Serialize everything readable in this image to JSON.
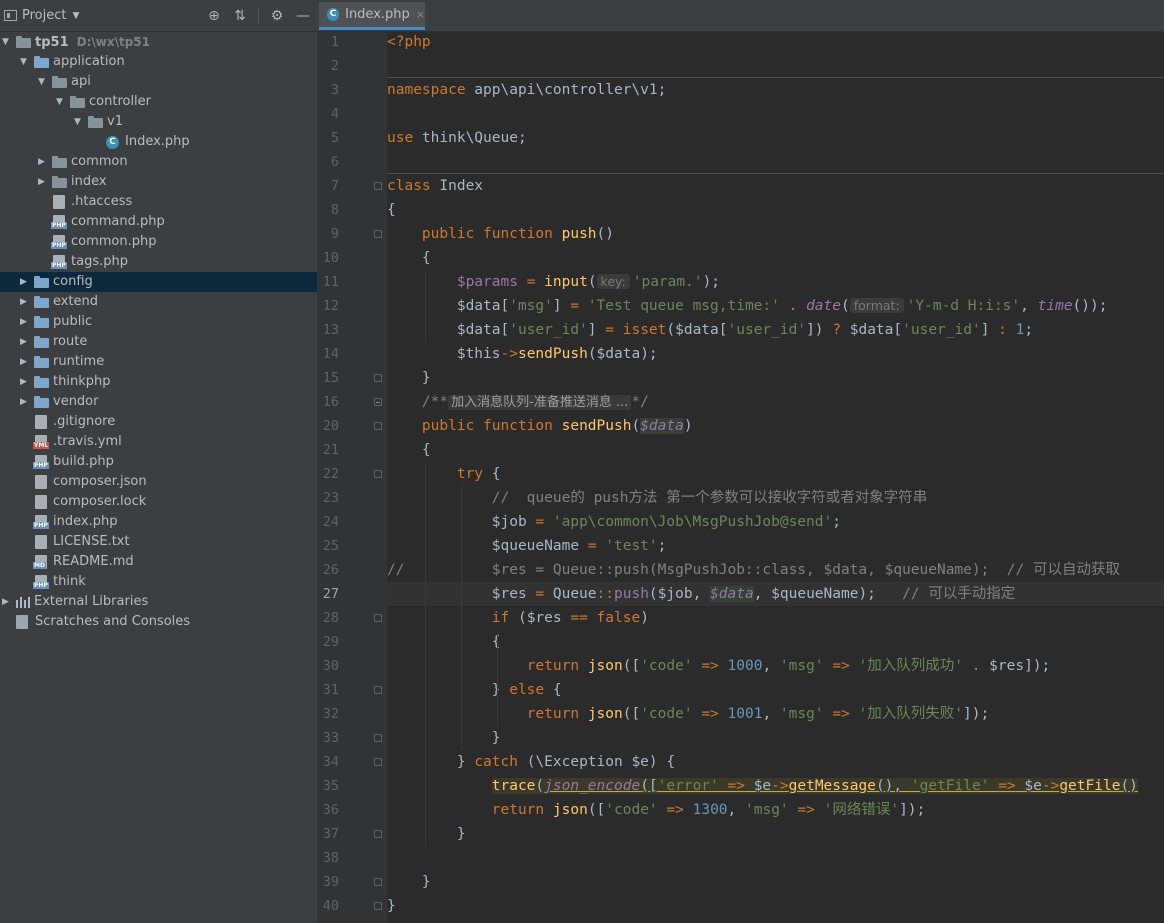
{
  "project_panel": {
    "title": "Project",
    "toolbar_icons": [
      "crosshair-icon",
      "collapse-icon",
      "gear-icon",
      "minimize-icon"
    ],
    "tree": [
      {
        "label": "tp51",
        "path": "D:\\wx\\tp51",
        "depth": 0,
        "type": "folder",
        "expanded": true,
        "bold": true
      },
      {
        "label": "application",
        "depth": 1,
        "type": "folder",
        "expanded": true
      },
      {
        "label": "api",
        "depth": 2,
        "type": "folder",
        "expanded": true
      },
      {
        "label": "controller",
        "depth": 3,
        "type": "folder",
        "expanded": true
      },
      {
        "label": "v1",
        "depth": 4,
        "type": "folder",
        "expanded": true
      },
      {
        "label": "Index.php",
        "depth": 5,
        "type": "class"
      },
      {
        "label": "common",
        "depth": 2,
        "type": "folder",
        "expanded": false
      },
      {
        "label": "index",
        "depth": 2,
        "type": "folder",
        "expanded": false
      },
      {
        "label": ".htaccess",
        "depth": 2,
        "type": "file-htaccess"
      },
      {
        "label": "command.php",
        "depth": 2,
        "type": "file-php"
      },
      {
        "label": "common.php",
        "depth": 2,
        "type": "file-php"
      },
      {
        "label": "tags.php",
        "depth": 2,
        "type": "file-php"
      },
      {
        "label": "config",
        "depth": 1,
        "type": "folder",
        "expanded": false,
        "selected": true
      },
      {
        "label": "extend",
        "depth": 1,
        "type": "folder",
        "expanded": false
      },
      {
        "label": "public",
        "depth": 1,
        "type": "folder",
        "expanded": false
      },
      {
        "label": "route",
        "depth": 1,
        "type": "folder",
        "expanded": false
      },
      {
        "label": "runtime",
        "depth": 1,
        "type": "folder",
        "expanded": false
      },
      {
        "label": "thinkphp",
        "depth": 1,
        "type": "folder",
        "expanded": false
      },
      {
        "label": "vendor",
        "depth": 1,
        "type": "folder",
        "expanded": false
      },
      {
        "label": ".gitignore",
        "depth": 1,
        "type": "file-git"
      },
      {
        "label": ".travis.yml",
        "depth": 1,
        "type": "file-yml"
      },
      {
        "label": "build.php",
        "depth": 1,
        "type": "file-php"
      },
      {
        "label": "composer.json",
        "depth": 1,
        "type": "file-composer"
      },
      {
        "label": "composer.lock",
        "depth": 1,
        "type": "file-composer"
      },
      {
        "label": "index.php",
        "depth": 1,
        "type": "file-php"
      },
      {
        "label": "LICENSE.txt",
        "depth": 1,
        "type": "file-txt"
      },
      {
        "label": "README.md",
        "depth": 1,
        "type": "file-md"
      },
      {
        "label": "think",
        "depth": 1,
        "type": "file-php"
      },
      {
        "label": "External Libraries",
        "depth": 0,
        "type": "libraries",
        "expanded": false
      },
      {
        "label": "Scratches and Consoles",
        "depth": 0,
        "type": "scratches"
      }
    ]
  },
  "editor": {
    "tab": {
      "label": "Index.php",
      "close": "×"
    },
    "current_line": 27,
    "lines": [
      {
        "n": "1",
        "html": "<span class='ph'>&lt;?php</span>"
      },
      {
        "n": "2",
        "html": ""
      },
      {
        "n": "3",
        "html": "<span class='kw'>namespace</span> app\\api\\controller\\v1;"
      },
      {
        "n": "4",
        "html": ""
      },
      {
        "n": "5",
        "html": "<span class='kw'>use</span> think\\Queue;"
      },
      {
        "n": "6",
        "html": ""
      },
      {
        "n": "7",
        "html": "<span class='kw'>class</span> Index"
      },
      {
        "n": "8",
        "html": "{"
      },
      {
        "n": "9",
        "html": "    <span class='kw'>public function</span> <span class='fn'>push</span>()"
      },
      {
        "n": "10",
        "html": "    {"
      },
      {
        "n": "11",
        "html": "        <span class='var'>$params</span> <span class='kw'>=</span> <span class='fn'>input</span>(<span class='hint'>key:</span><span class='str'>'param.'</span>);"
      },
      {
        "n": "12",
        "html": "        $data[<span class='str'>'msg'</span>] <span class='kw'>=</span> <span class='str'>'Test queue msg,time:'</span> <span class='kw'>.</span> <span class='itf'>date</span>(<span class='hint'>format:</span><span class='str'>'Y-m-d H:i:s'</span>, <span class='itf'>time</span>());"
      },
      {
        "n": "13",
        "html": "        $data[<span class='str'>'user_id'</span>] <span class='kw'>=</span> <span class='kw'>isset</span>($data[<span class='str'>'user_id'</span>]) <span class='kw'>?</span> $data[<span class='str'>'user_id'</span>] <span class='kw'>:</span> <span class='num'>1</span>;"
      },
      {
        "n": "14",
        "html": "        $this<span class='kw'>-&gt;</span><span class='fn'>sendPush</span>($data);"
      },
      {
        "n": "15",
        "html": "    }"
      },
      {
        "n": "16",
        "html": "    <span class='cmt'>/**</span><span class='folded'>加入消息队列-准备推送消息 ...</span><span class='cmt'>*/</span>"
      },
      {
        "n": "20",
        "html": "    <span class='kw'>public function</span> <span class='fn'>sendPush</span>(<span class='varp'>$data</span>)"
      },
      {
        "n": "21",
        "html": "    {"
      },
      {
        "n": "22",
        "html": "        <span class='kw'>try</span> {"
      },
      {
        "n": "23",
        "html": "            <span class='cmt'>//  queue的 push方法 第一个参数可以接收字符或者对象字符串</span>"
      },
      {
        "n": "24",
        "html": "            $job <span class='kw'>=</span> <span class='str'>'app\\common\\Job\\MsgPushJob@send'</span>;"
      },
      {
        "n": "25",
        "html": "            $queueName <span class='kw'>=</span> <span class='str'>'test'</span>;"
      },
      {
        "n": "26",
        "html": "<span class='cmt'>//          $res = Queue::push(MsgPushJob::class, $data, $queueName);  // 可以自动获取</span>"
      },
      {
        "n": "27",
        "html": "            $res <span class='kw'>=</span> Queue<span class='kw'>::</span><span class='var'>push</span>($job, <span class='varp'>$data</span>, $queueName);   <span class='cmt'>// 可以手动指定</span>"
      },
      {
        "n": "28",
        "html": "            <span class='kw'>if</span> ($res <span class='kw'>==</span> <span class='kw'>false</span>)"
      },
      {
        "n": "29",
        "html": "            {"
      },
      {
        "n": "30",
        "html": "                <span class='kw'>return</span> <span class='fn'>json</span>([<span class='str'>'code'</span> <span class='kw'>=&gt;</span> <span class='num'>1000</span>, <span class='str'>'msg'</span> <span class='kw'>=&gt;</span> <span class='str'>'加入队列成功'</span> <span class='kw'>.</span> $res]);"
      },
      {
        "n": "31",
        "html": "            } <span class='kw'>else</span> {"
      },
      {
        "n": "32",
        "html": "                <span class='kw'>return</span> <span class='fn'>json</span>([<span class='str'>'code'</span> <span class='kw'>=&gt;</span> <span class='num'>1001</span>, <span class='str'>'msg'</span> <span class='kw'>=&gt;</span> <span class='str'>'加入队列失败'</span>]);"
      },
      {
        "n": "33",
        "html": "            }"
      },
      {
        "n": "34",
        "html": "        } <span class='kw'>catch</span> (\\Exception $e) {"
      },
      {
        "n": "35",
        "html": "            <span class='trace-hl'><span class='fn'>trace</span>(<span class='itf u'>json_encode</span><span class='u'>([<span class='str'>'error'</span> <span class='kw'>=&gt;</span> $e<span class='kw'>-&gt;</span><span class='fn'>getMessage</span>(), <span class='str'>'getFile'</span> <span class='kw'>=&gt;</span> $e<span class='kw'>-&gt;</span><span class='fn'>getFile</span>()</span></span>"
      },
      {
        "n": "36",
        "html": "            <span class='kw'>return</span> <span class='fn'>json</span>([<span class='str'>'code'</span> <span class='kw'>=&gt;</span> <span class='num'>1300</span>, <span class='str'>'msg'</span> <span class='kw'>=&gt;</span> <span class='str'>'网络错误'</span>]);"
      },
      {
        "n": "37",
        "html": "        }"
      },
      {
        "n": "38",
        "html": ""
      },
      {
        "n": "39",
        "html": "    }"
      },
      {
        "n": "40",
        "html": "}"
      }
    ]
  }
}
